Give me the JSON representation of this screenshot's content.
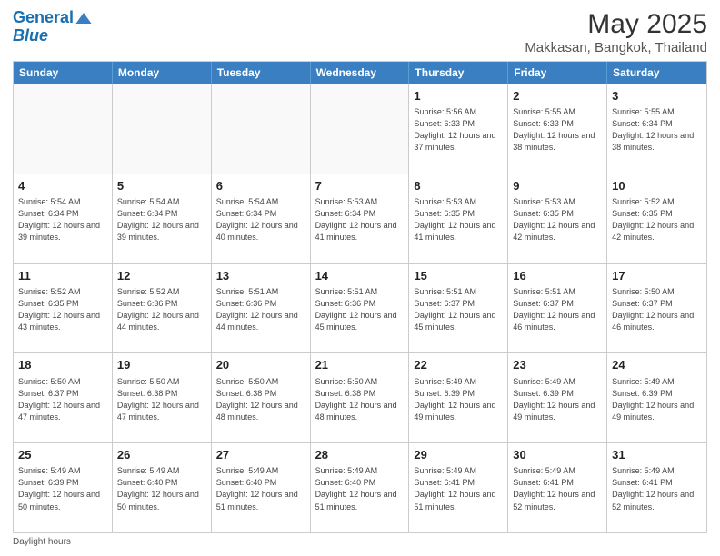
{
  "header": {
    "logo_line1": "General",
    "logo_line2": "Blue",
    "main_title": "May 2025",
    "subtitle": "Makkasan, Bangkok, Thailand"
  },
  "footer": {
    "daylight_label": "Daylight hours"
  },
  "days_of_week": [
    "Sunday",
    "Monday",
    "Tuesday",
    "Wednesday",
    "Thursday",
    "Friday",
    "Saturday"
  ],
  "weeks": [
    {
      "cells": [
        {
          "day": "",
          "empty": true
        },
        {
          "day": "",
          "empty": true
        },
        {
          "day": "",
          "empty": true
        },
        {
          "day": "",
          "empty": true
        },
        {
          "day": "1",
          "sunrise": "Sunrise: 5:56 AM",
          "sunset": "Sunset: 6:33 PM",
          "daylight": "Daylight: 12 hours and 37 minutes."
        },
        {
          "day": "2",
          "sunrise": "Sunrise: 5:55 AM",
          "sunset": "Sunset: 6:33 PM",
          "daylight": "Daylight: 12 hours and 38 minutes."
        },
        {
          "day": "3",
          "sunrise": "Sunrise: 5:55 AM",
          "sunset": "Sunset: 6:34 PM",
          "daylight": "Daylight: 12 hours and 38 minutes."
        }
      ]
    },
    {
      "cells": [
        {
          "day": "4",
          "sunrise": "Sunrise: 5:54 AM",
          "sunset": "Sunset: 6:34 PM",
          "daylight": "Daylight: 12 hours and 39 minutes."
        },
        {
          "day": "5",
          "sunrise": "Sunrise: 5:54 AM",
          "sunset": "Sunset: 6:34 PM",
          "daylight": "Daylight: 12 hours and 39 minutes."
        },
        {
          "day": "6",
          "sunrise": "Sunrise: 5:54 AM",
          "sunset": "Sunset: 6:34 PM",
          "daylight": "Daylight: 12 hours and 40 minutes."
        },
        {
          "day": "7",
          "sunrise": "Sunrise: 5:53 AM",
          "sunset": "Sunset: 6:34 PM",
          "daylight": "Daylight: 12 hours and 41 minutes."
        },
        {
          "day": "8",
          "sunrise": "Sunrise: 5:53 AM",
          "sunset": "Sunset: 6:35 PM",
          "daylight": "Daylight: 12 hours and 41 minutes."
        },
        {
          "day": "9",
          "sunrise": "Sunrise: 5:53 AM",
          "sunset": "Sunset: 6:35 PM",
          "daylight": "Daylight: 12 hours and 42 minutes."
        },
        {
          "day": "10",
          "sunrise": "Sunrise: 5:52 AM",
          "sunset": "Sunset: 6:35 PM",
          "daylight": "Daylight: 12 hours and 42 minutes."
        }
      ]
    },
    {
      "cells": [
        {
          "day": "11",
          "sunrise": "Sunrise: 5:52 AM",
          "sunset": "Sunset: 6:35 PM",
          "daylight": "Daylight: 12 hours and 43 minutes."
        },
        {
          "day": "12",
          "sunrise": "Sunrise: 5:52 AM",
          "sunset": "Sunset: 6:36 PM",
          "daylight": "Daylight: 12 hours and 44 minutes."
        },
        {
          "day": "13",
          "sunrise": "Sunrise: 5:51 AM",
          "sunset": "Sunset: 6:36 PM",
          "daylight": "Daylight: 12 hours and 44 minutes."
        },
        {
          "day": "14",
          "sunrise": "Sunrise: 5:51 AM",
          "sunset": "Sunset: 6:36 PM",
          "daylight": "Daylight: 12 hours and 45 minutes."
        },
        {
          "day": "15",
          "sunrise": "Sunrise: 5:51 AM",
          "sunset": "Sunset: 6:37 PM",
          "daylight": "Daylight: 12 hours and 45 minutes."
        },
        {
          "day": "16",
          "sunrise": "Sunrise: 5:51 AM",
          "sunset": "Sunset: 6:37 PM",
          "daylight": "Daylight: 12 hours and 46 minutes."
        },
        {
          "day": "17",
          "sunrise": "Sunrise: 5:50 AM",
          "sunset": "Sunset: 6:37 PM",
          "daylight": "Daylight: 12 hours and 46 minutes."
        }
      ]
    },
    {
      "cells": [
        {
          "day": "18",
          "sunrise": "Sunrise: 5:50 AM",
          "sunset": "Sunset: 6:37 PM",
          "daylight": "Daylight: 12 hours and 47 minutes."
        },
        {
          "day": "19",
          "sunrise": "Sunrise: 5:50 AM",
          "sunset": "Sunset: 6:38 PM",
          "daylight": "Daylight: 12 hours and 47 minutes."
        },
        {
          "day": "20",
          "sunrise": "Sunrise: 5:50 AM",
          "sunset": "Sunset: 6:38 PM",
          "daylight": "Daylight: 12 hours and 48 minutes."
        },
        {
          "day": "21",
          "sunrise": "Sunrise: 5:50 AM",
          "sunset": "Sunset: 6:38 PM",
          "daylight": "Daylight: 12 hours and 48 minutes."
        },
        {
          "day": "22",
          "sunrise": "Sunrise: 5:49 AM",
          "sunset": "Sunset: 6:39 PM",
          "daylight": "Daylight: 12 hours and 49 minutes."
        },
        {
          "day": "23",
          "sunrise": "Sunrise: 5:49 AM",
          "sunset": "Sunset: 6:39 PM",
          "daylight": "Daylight: 12 hours and 49 minutes."
        },
        {
          "day": "24",
          "sunrise": "Sunrise: 5:49 AM",
          "sunset": "Sunset: 6:39 PM",
          "daylight": "Daylight: 12 hours and 49 minutes."
        }
      ]
    },
    {
      "cells": [
        {
          "day": "25",
          "sunrise": "Sunrise: 5:49 AM",
          "sunset": "Sunset: 6:39 PM",
          "daylight": "Daylight: 12 hours and 50 minutes."
        },
        {
          "day": "26",
          "sunrise": "Sunrise: 5:49 AM",
          "sunset": "Sunset: 6:40 PM",
          "daylight": "Daylight: 12 hours and 50 minutes."
        },
        {
          "day": "27",
          "sunrise": "Sunrise: 5:49 AM",
          "sunset": "Sunset: 6:40 PM",
          "daylight": "Daylight: 12 hours and 51 minutes."
        },
        {
          "day": "28",
          "sunrise": "Sunrise: 5:49 AM",
          "sunset": "Sunset: 6:40 PM",
          "daylight": "Daylight: 12 hours and 51 minutes."
        },
        {
          "day": "29",
          "sunrise": "Sunrise: 5:49 AM",
          "sunset": "Sunset: 6:41 PM",
          "daylight": "Daylight: 12 hours and 51 minutes."
        },
        {
          "day": "30",
          "sunrise": "Sunrise: 5:49 AM",
          "sunset": "Sunset: 6:41 PM",
          "daylight": "Daylight: 12 hours and 52 minutes."
        },
        {
          "day": "31",
          "sunrise": "Sunrise: 5:49 AM",
          "sunset": "Sunset: 6:41 PM",
          "daylight": "Daylight: 12 hours and 52 minutes."
        }
      ]
    }
  ]
}
